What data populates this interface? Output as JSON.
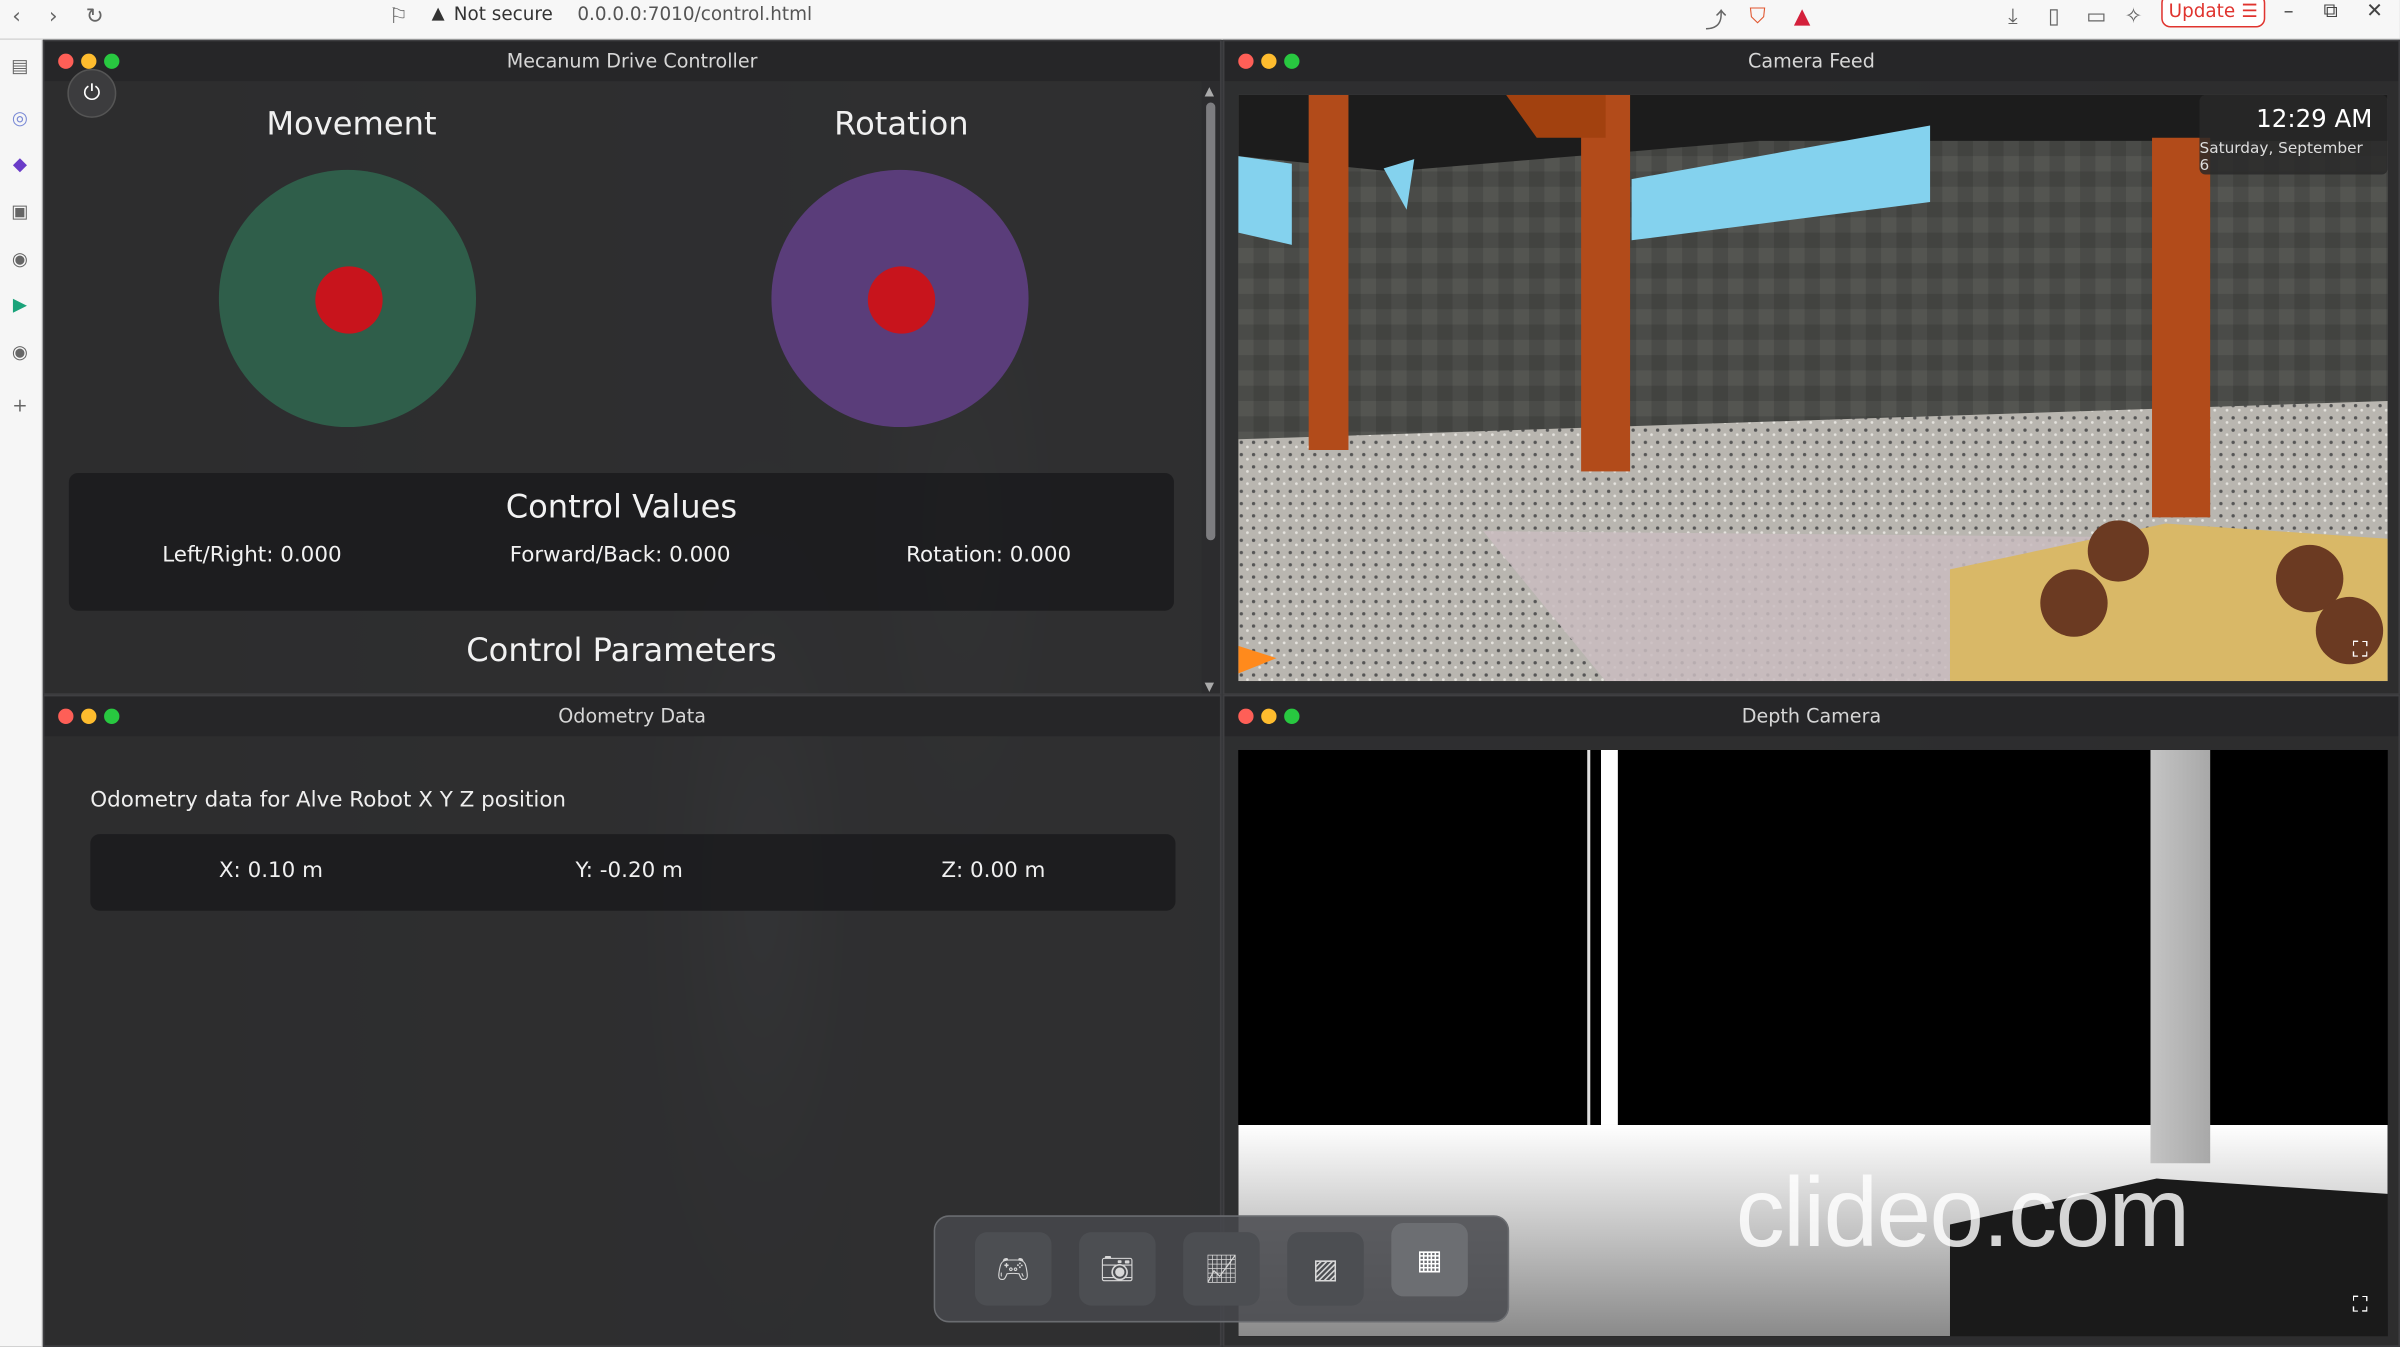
{
  "browser": {
    "security": "Not secure",
    "url": "0.0.0.0:7010/control.html",
    "update": "Update"
  },
  "control": {
    "title": "Mecanum Drive Controller",
    "movement": "Movement",
    "rotation": "Rotation",
    "values_title": "Control Values",
    "left_right": "Left/Right: 0.000",
    "forward_back": "Forward/Back: 0.000",
    "rotation_value": "Rotation: 0.000",
    "params_title": "Control Parameters",
    "colors": {
      "movement_pad": "#2f5e4a",
      "rotation_pad": "#5a3d7a",
      "knob": "#c8141c"
    }
  },
  "camera": {
    "title": "Camera Feed",
    "time": "12:29 AM",
    "date": "Saturday, September 6"
  },
  "odometry": {
    "title": "Odometry Data",
    "description": "Odometry data for Alve Robot X Y Z position",
    "x": "X: 0.10 m",
    "y": "Y: -0.20 m",
    "z": "Z: 0.00 m"
  },
  "depth": {
    "title": "Depth Camera",
    "watermark": "clideo.com"
  },
  "dock": {
    "items": [
      "gamepad-icon",
      "camera-icon",
      "chart-icon",
      "image-icon",
      "grid-icon"
    ],
    "active": "grid-icon"
  }
}
